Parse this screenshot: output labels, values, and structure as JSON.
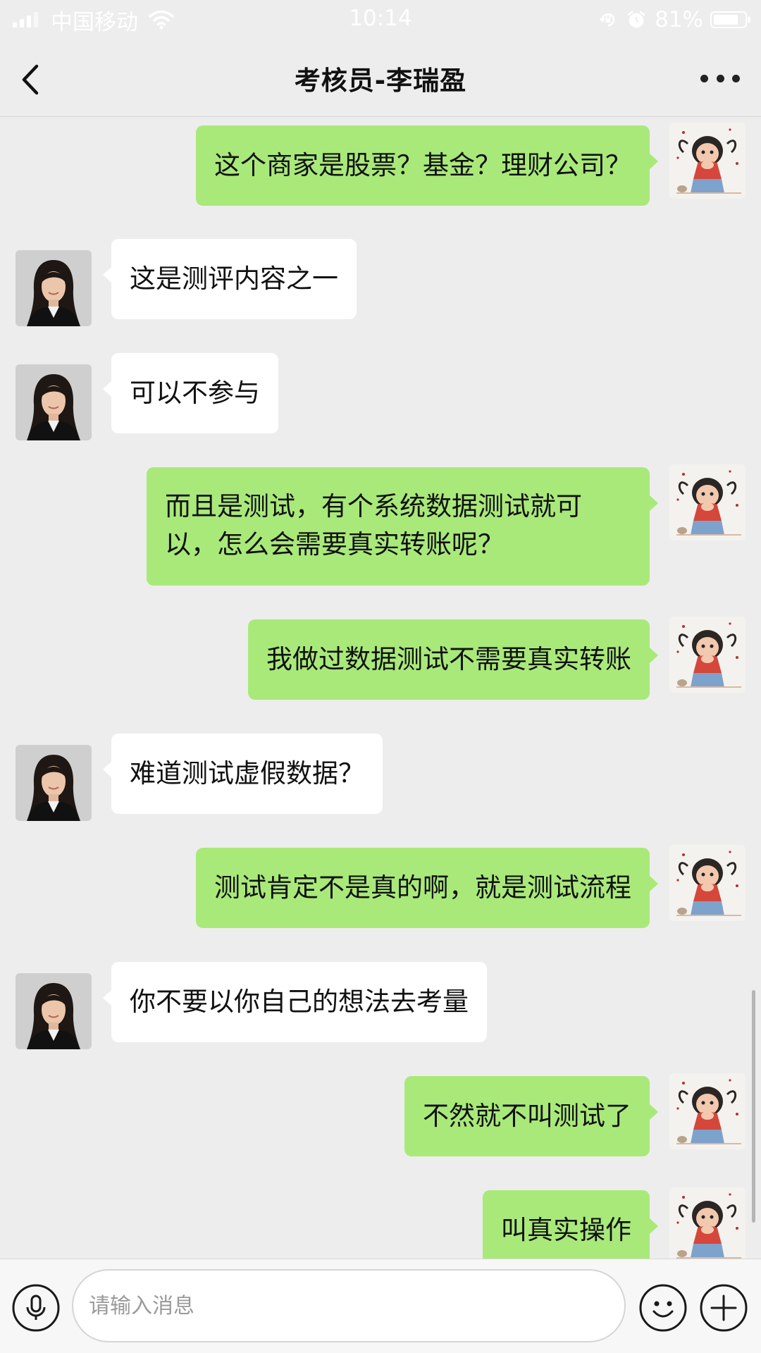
{
  "status_bar": {
    "carrier": "中国移动",
    "time": "10:14",
    "battery": "81%",
    "battery_level": 0.81,
    "icons": [
      "signal-icon",
      "wifi-icon",
      "rotation-lock-icon",
      "alarm-icon",
      "battery-icon"
    ]
  },
  "header": {
    "title": "考核员-李瑞盈",
    "back_icon": "chevron-left-icon",
    "more_icon": "more-icon"
  },
  "messages": [
    {
      "side": "out",
      "text": "这个商家是股票？基金？理财公司？"
    },
    {
      "side": "in",
      "text": "这是测评内容之一"
    },
    {
      "side": "in",
      "text": "可以不参与"
    },
    {
      "side": "out",
      "text": "而且是测试，有个系统数据测试就可以，怎么会需要真实转账呢？"
    },
    {
      "side": "out",
      "text": "我做过数据测试不需要真实转账"
    },
    {
      "side": "in",
      "text": "难道测试虚假数据？"
    },
    {
      "side": "out",
      "text": "测试肯定不是真的啊，就是测试流程"
    },
    {
      "side": "in",
      "text": "你不要以你自己的想法去考量"
    },
    {
      "side": "out",
      "text": "不然就不叫测试了"
    },
    {
      "side": "out",
      "text": "叫真实操作"
    }
  ],
  "input": {
    "placeholder": "请输入消息",
    "value": "",
    "icons": [
      "microphone-icon",
      "emoji-icon",
      "plus-icon"
    ]
  },
  "colors": {
    "background": "#ededed",
    "outgoing_bubble": "#a9e97a",
    "incoming_bubble": "#ffffff"
  }
}
